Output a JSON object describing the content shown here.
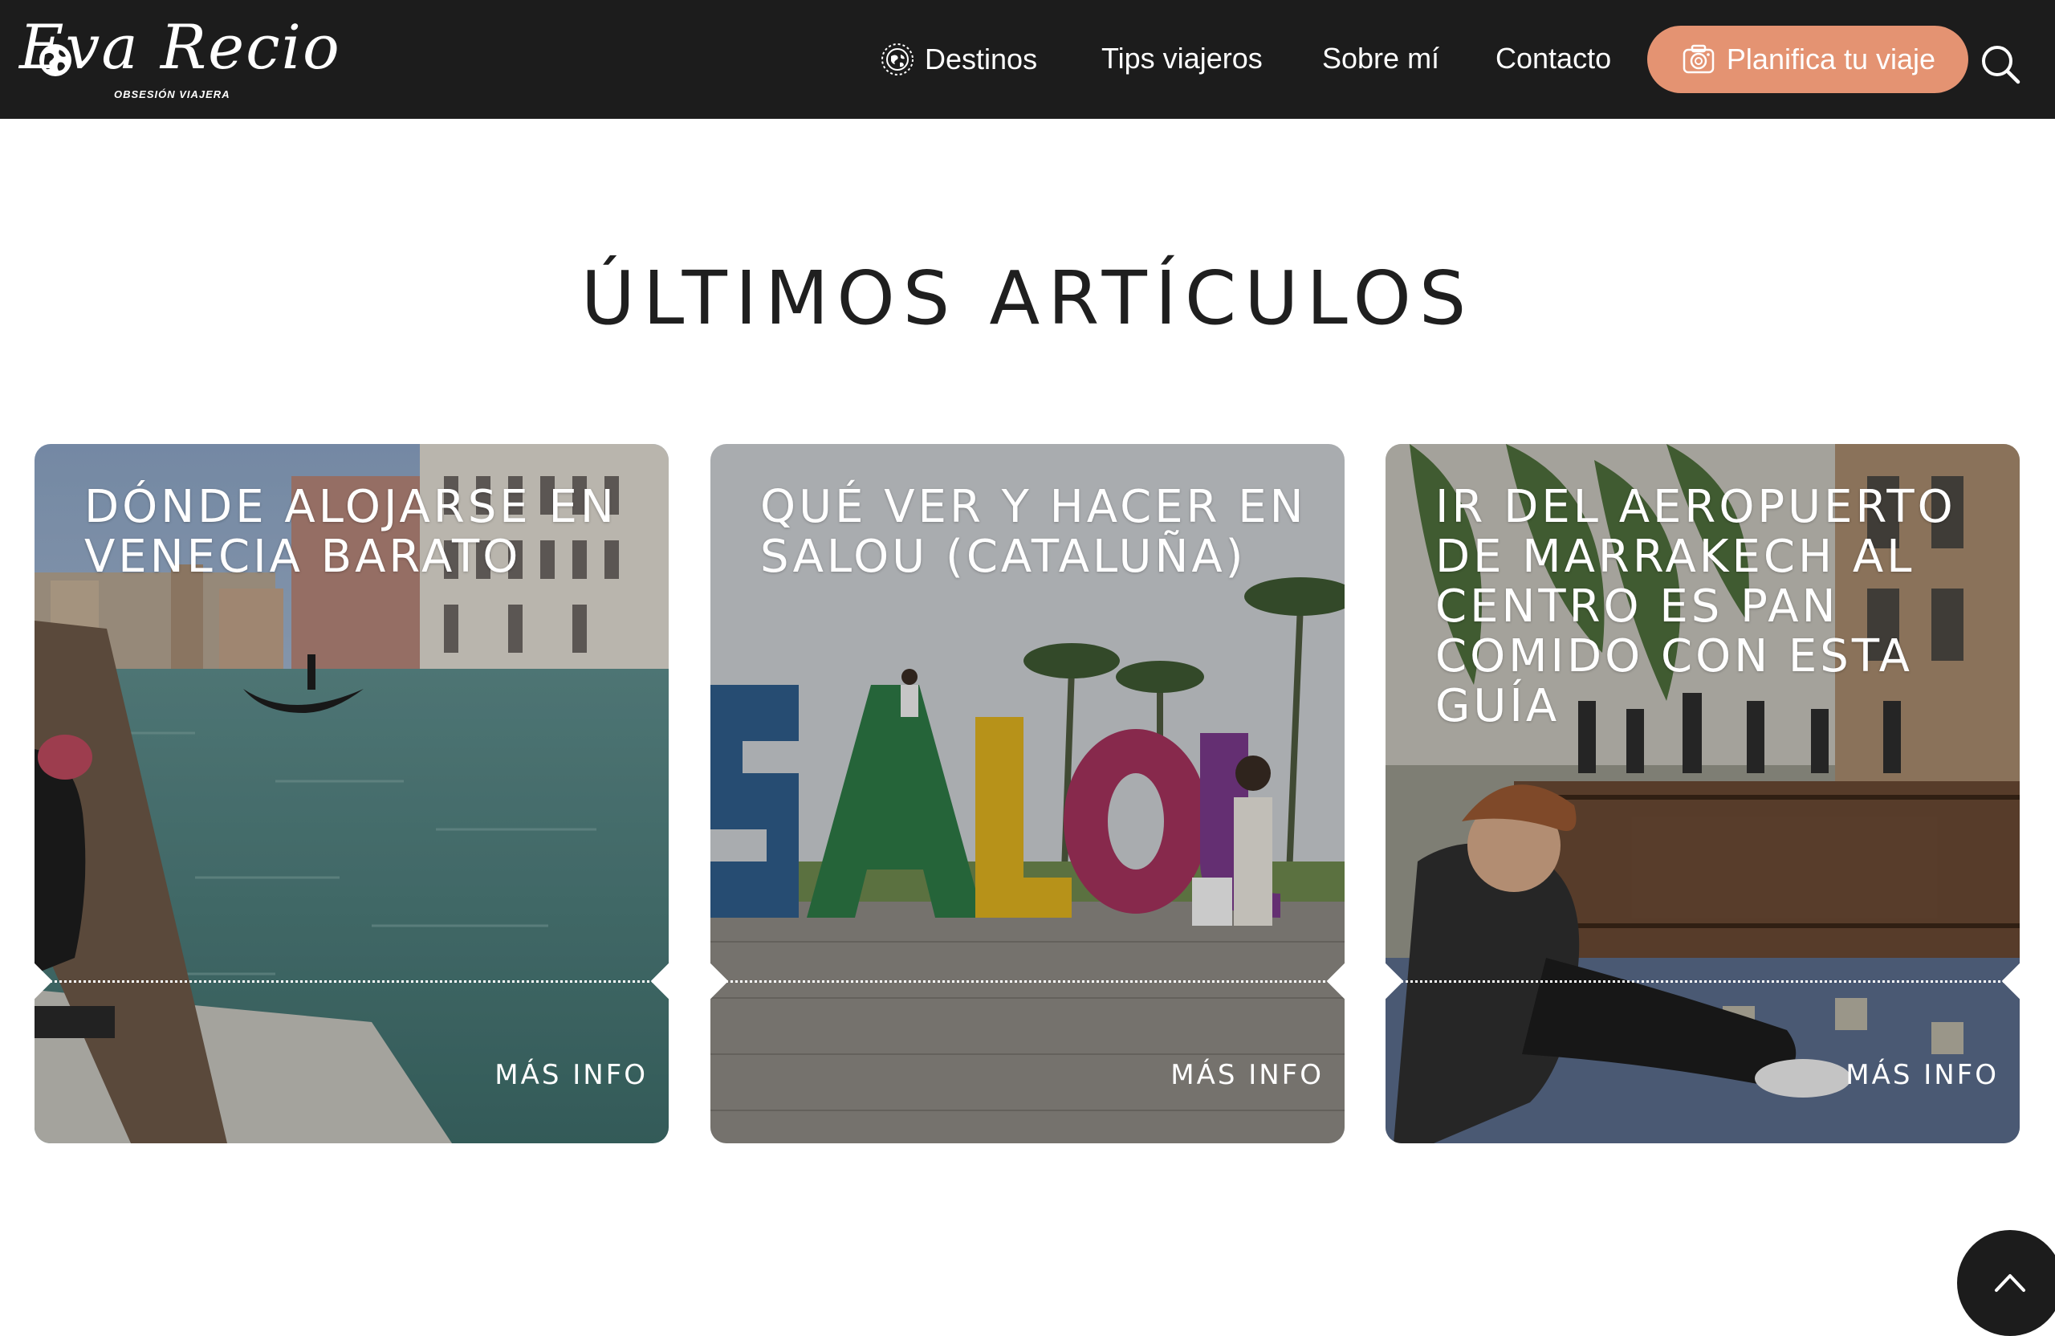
{
  "brand": {
    "name": "Eva Recio",
    "tagline": "OBSESIÓN VIAJERA"
  },
  "nav": {
    "items": [
      {
        "label": "Destinos",
        "icon": "globe-icon"
      },
      {
        "label": "Tips viajeros"
      },
      {
        "label": "Sobre mí"
      },
      {
        "label": "Contacto"
      }
    ],
    "cta": {
      "label": "Planifica tu viaje",
      "icon": "camera-icon"
    },
    "search_icon": "search-icon"
  },
  "section": {
    "title": "ÚLTIMOS ARTÍCULOS"
  },
  "articles": [
    {
      "title": "Dónde alojarse en Venecia barato",
      "more": "MÁS INFO"
    },
    {
      "title": "Qué ver y hacer en Salou (Cataluña)",
      "more": "MÁS INFO"
    },
    {
      "title": "Ir del aeropuerto de Marrakech al centro es pan comido con esta guía",
      "more": "MÁS INFO"
    }
  ],
  "colors": {
    "header_bg": "#1c1c1c",
    "cta_bg": "#e49372",
    "text_dark": "#1f1f1f"
  },
  "back_to_top_icon": "chevron-up-icon"
}
